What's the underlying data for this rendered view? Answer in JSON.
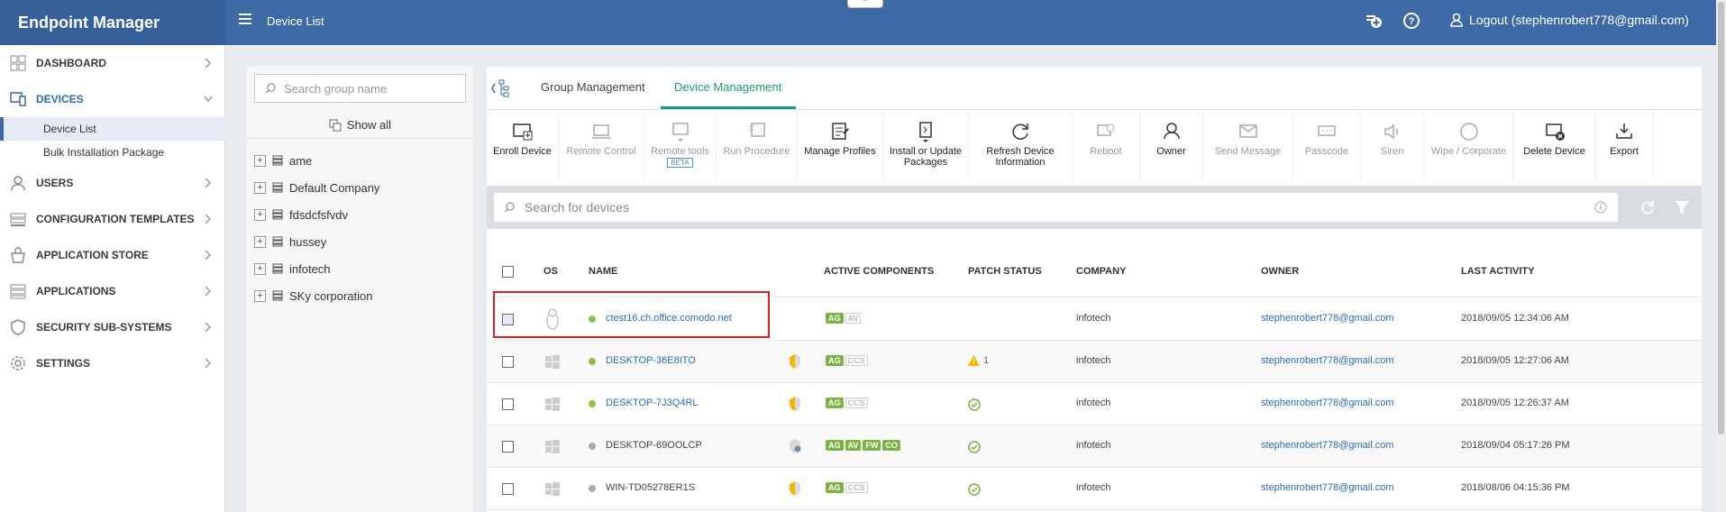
{
  "app": {
    "title": "Endpoint Manager",
    "page_title": "Device List",
    "logout_label": "Logout (stephenrobert778@gmail.com)"
  },
  "sidebar": {
    "items": [
      {
        "label": "DASHBOARD"
      },
      {
        "label": "DEVICES"
      },
      {
        "label": "USERS"
      },
      {
        "label": "CONFIGURATION TEMPLATES"
      },
      {
        "label": "APPLICATION STORE"
      },
      {
        "label": "APPLICATIONS"
      },
      {
        "label": "SECURITY SUB-SYSTEMS"
      },
      {
        "label": "SETTINGS"
      }
    ],
    "sub_items": [
      {
        "label": "Device List"
      },
      {
        "label": "Bulk Installation Package"
      }
    ]
  },
  "groups": {
    "search_placeholder": "Search group name",
    "show_all": "Show all",
    "items": [
      "ame",
      "Default Company",
      "fdsdcfsfvdv",
      "hussey",
      "infotech",
      "SKy corporation"
    ]
  },
  "tabs": [
    "Group Management",
    "Device Management"
  ],
  "toolbar": {
    "enroll": "Enroll Device",
    "remote_control": "Remote Control",
    "remote_tools": "Remote tools",
    "beta": "BETA",
    "run_procedure": "Run Procedure",
    "manage_profiles": "Manage Profiles",
    "install_update_1": "Install or Update",
    "install_update_2": "Packages",
    "refresh_1": "Refresh Device",
    "refresh_2": "Information",
    "reboot": "Reboot",
    "owner": "Owner",
    "send_message": "Send Message",
    "passcode": "Passcode",
    "siren": "Siren",
    "wipe": "Wipe / Corporate",
    "delete": "Delete Device",
    "export": "Export"
  },
  "device_search_placeholder": "Search for devices",
  "table": {
    "headers": {
      "os": "OS",
      "name": "NAME",
      "active": "ACTIVE COMPONENTS",
      "patch": "PATCH STATUS",
      "company": "COMPANY",
      "owner": "OWNER",
      "last": "LAST ACTIVITY"
    },
    "rows": [
      {
        "name": "ctest16.ch.office.comodo.net",
        "company": "infotech",
        "owner": "stephenrobert778@gmail.com",
        "last": "2018/09/05 12:34:06 AM",
        "patch": ""
      },
      {
        "name": "DESKTOP-36E8ITO",
        "company": "infotech",
        "owner": "stephenrobert778@gmail.com",
        "last": "2018/09/05 12:27:06 AM",
        "patch": "1"
      },
      {
        "name": "DESKTOP-7J3Q4RL",
        "company": "infotech",
        "owner": "stephenrobert778@gmail.com",
        "last": "2018/09/05 12:26:37 AM",
        "patch": ""
      },
      {
        "name": "DESKTOP-69OOLCP",
        "company": "infotech",
        "owner": "stephenrobert778@gmail.com",
        "last": "2018/09/04 05:17:26 PM",
        "patch": ""
      },
      {
        "name": "WIN-TD05278ER1S",
        "company": "infotech",
        "owner": "stephenrobert778@gmail.com",
        "last": "2018/08/06 04:15:36 PM",
        "patch": ""
      }
    ],
    "badges": {
      "ag": "AG",
      "av": "AV",
      "ccs": "CCS",
      "fw": "FW",
      "co": "CO"
    }
  },
  "colors": {
    "header": "#3d6aa5",
    "accent": "#1a9a80",
    "online": "#8bc34a",
    "offline": "#aaaaaa",
    "link": "#2a6bb3"
  }
}
